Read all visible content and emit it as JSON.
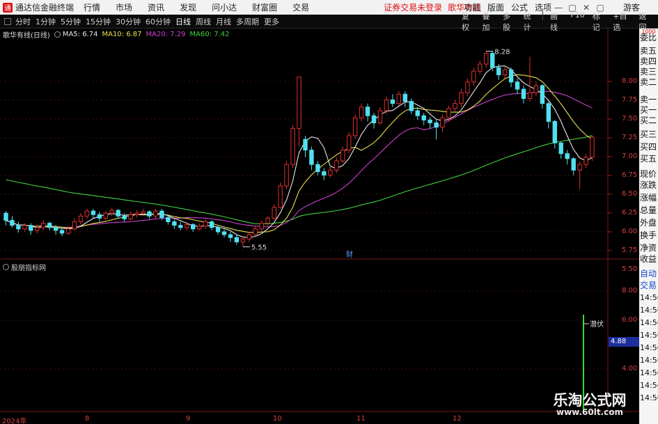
{
  "titlebar": {
    "app_title": "通达信金融终端",
    "logo_glyph": "通",
    "menu": [
      "行情",
      "市场",
      "资讯",
      "发现",
      "问小达",
      "财富圈",
      "交易"
    ],
    "notice": "证券交易未登录",
    "stock_name": "歌华有线",
    "right_menu": [
      "功能",
      "版面",
      "公式",
      "选项"
    ],
    "window_controls": [
      "—",
      "□",
      "✕",
      "▢"
    ],
    "guest": "游客"
  },
  "toolbar": {
    "periods": [
      "分时",
      "1分钟",
      "5分钟",
      "15分钟",
      "30分钟",
      "60分钟",
      "日线",
      "周线",
      "月线",
      "多周期",
      "更多"
    ],
    "active_period": "日线",
    "right_buttons": [
      "复权",
      "叠加",
      "多股",
      "统计",
      "画线",
      "F10",
      "标记",
      "+自选",
      "返回"
    ]
  },
  "legend": {
    "stock_label": "歌华有线(日线)",
    "ma": [
      {
        "label": "MA5: 6.74",
        "color": "#e8e8e8"
      },
      {
        "label": "MA10: 6.87",
        "color": "#e8e050"
      },
      {
        "label": "MA20: 7.29",
        "color": "#d040d0"
      },
      {
        "label": "MA60: 7.42",
        "color": "#40d040"
      }
    ]
  },
  "sub_panel": {
    "indicator_name": "股朋指标网",
    "signal_label": "潜伏",
    "readout": "4.88"
  },
  "axis": {
    "price_ticks": [
      "8.00",
      "7.75",
      "7.50",
      "7.25",
      "7.00",
      "6.75",
      "6.50",
      "6.25",
      "6.00",
      "5.75",
      "5.50"
    ],
    "sub_ticks": [
      "8.00",
      "6.00",
      "4.00"
    ],
    "dates": [
      "2024年",
      "8",
      "9",
      "10",
      "11",
      "12"
    ]
  },
  "annotations": {
    "high_label": "8.28",
    "low_label": "5.55",
    "finance_mark": "财"
  },
  "sidepanel": {
    "top_mark": "1000",
    "items": [
      "委比",
      "卖五",
      "卖四",
      "卖三",
      "卖二",
      "卖一",
      "买一",
      "买二",
      "买三",
      "买四",
      "买五",
      "现价",
      "涨跌",
      "涨幅",
      "总量",
      "外盘",
      "换手",
      "净资",
      "收益",
      "自动",
      "交易"
    ],
    "times": [
      "14:56",
      "14:56",
      "14:56",
      "14:56",
      "14:56",
      "14:56",
      "14:56",
      "14:56",
      "14:56"
    ]
  },
  "watermark": {
    "line1": "乐淘公式网",
    "line2": "www.60lt.com"
  },
  "chart_data": {
    "type": "candlestick",
    "price_range": [
      5.4,
      8.45
    ],
    "up_color": "#e03030",
    "down_color": "#50e0f0",
    "candles": [
      [
        6.02,
        5.92,
        6.05,
        5.85
      ],
      [
        5.92,
        5.85,
        5.98,
        5.82
      ],
      [
        5.85,
        5.8,
        5.9,
        5.75
      ],
      [
        5.8,
        5.85,
        5.88,
        5.76
      ],
      [
        5.85,
        5.78,
        5.88,
        5.72
      ],
      [
        5.78,
        5.82,
        5.86,
        5.74
      ],
      [
        5.82,
        5.88,
        5.92,
        5.78
      ],
      [
        5.88,
        5.82,
        5.9,
        5.78
      ],
      [
        5.82,
        5.78,
        5.85,
        5.72
      ],
      [
        5.78,
        5.74,
        5.82,
        5.7
      ],
      [
        5.74,
        5.8,
        5.84,
        5.72
      ],
      [
        5.8,
        5.9,
        5.95,
        5.78
      ],
      [
        5.9,
        5.98,
        6.02,
        5.86
      ],
      [
        5.98,
        6.05,
        6.08,
        5.94
      ],
      [
        6.05,
        6.0,
        6.08,
        5.95
      ],
      [
        6.0,
        5.95,
        6.04,
        5.9
      ],
      [
        5.95,
        6.02,
        6.05,
        5.92
      ],
      [
        6.02,
        6.06,
        6.1,
        5.98
      ],
      [
        6.06,
        5.98,
        6.08,
        5.94
      ],
      [
        5.98,
        5.94,
        6.02,
        5.9
      ],
      [
        5.94,
        6.0,
        6.04,
        5.92
      ],
      [
        6.0,
        6.02,
        6.06,
        5.96
      ],
      [
        6.02,
        6.04,
        6.08,
        5.98
      ],
      [
        6.04,
        5.98,
        6.06,
        5.94
      ],
      [
        5.98,
        6.05,
        6.08,
        5.95
      ],
      [
        6.05,
        5.96,
        6.08,
        5.92
      ],
      [
        5.96,
        5.9,
        6.0,
        5.86
      ],
      [
        5.9,
        5.85,
        5.94,
        5.8
      ],
      [
        5.85,
        5.82,
        5.9,
        5.78
      ],
      [
        5.82,
        5.86,
        5.9,
        5.78
      ],
      [
        5.86,
        5.8,
        5.88,
        5.76
      ],
      [
        5.8,
        5.84,
        5.88,
        5.78
      ],
      [
        5.84,
        5.9,
        5.94,
        5.8
      ],
      [
        5.9,
        5.82,
        5.92,
        5.78
      ],
      [
        5.82,
        5.76,
        5.85,
        5.72
      ],
      [
        5.76,
        5.72,
        5.8,
        5.68
      ],
      [
        5.72,
        5.68,
        5.76,
        5.62
      ],
      [
        5.68,
        5.62,
        5.72,
        5.58
      ],
      [
        5.62,
        5.66,
        5.7,
        5.55
      ],
      [
        5.66,
        5.72,
        5.76,
        5.62
      ],
      [
        5.72,
        5.8,
        5.84,
        5.7
      ],
      [
        5.8,
        5.88,
        5.92,
        5.76
      ],
      [
        5.88,
        5.95,
        5.98,
        5.84
      ],
      [
        5.95,
        6.1,
        6.14,
        5.92
      ],
      [
        6.1,
        6.4,
        6.45,
        6.08
      ],
      [
        6.4,
        6.7,
        6.75,
        6.35
      ],
      [
        6.7,
        7.2,
        7.25,
        6.65
      ],
      [
        7.2,
        7.92,
        7.92,
        6.95
      ],
      [
        7.05,
        6.9,
        7.1,
        6.8
      ],
      [
        6.9,
        6.7,
        6.95,
        6.62
      ],
      [
        6.7,
        6.6,
        6.75,
        6.55
      ],
      [
        6.6,
        6.55,
        6.65,
        6.48
      ],
      [
        6.55,
        6.62,
        6.68,
        6.52
      ],
      [
        6.62,
        6.75,
        6.8,
        6.58
      ],
      [
        6.75,
        6.9,
        6.95,
        6.72
      ],
      [
        6.9,
        7.1,
        7.15,
        6.85
      ],
      [
        7.1,
        7.35,
        7.4,
        7.05
      ],
      [
        7.35,
        7.5,
        7.55,
        7.3
      ],
      [
        7.5,
        7.38,
        7.55,
        7.3
      ],
      [
        7.38,
        7.28,
        7.42,
        7.2
      ],
      [
        7.28,
        7.45,
        7.5,
        7.25
      ],
      [
        7.45,
        7.6,
        7.65,
        7.4
      ],
      [
        7.6,
        7.55,
        7.68,
        7.5
      ],
      [
        7.55,
        7.68,
        7.72,
        7.52
      ],
      [
        7.68,
        7.58,
        7.72,
        7.5
      ],
      [
        7.58,
        7.45,
        7.62,
        7.4
      ],
      [
        7.45,
        7.38,
        7.5,
        7.32
      ],
      [
        7.38,
        7.32,
        7.42,
        7.25
      ],
      [
        7.32,
        7.28,
        7.36,
        7.2
      ],
      [
        7.28,
        7.22,
        7.32,
        7.05
      ],
      [
        7.22,
        7.35,
        7.4,
        7.15
      ],
      [
        7.35,
        7.48,
        7.52,
        7.3
      ],
      [
        7.48,
        7.55,
        7.6,
        7.44
      ],
      [
        7.55,
        7.7,
        7.75,
        7.5
      ],
      [
        7.7,
        7.85,
        7.9,
        7.65
      ],
      [
        7.85,
        8.0,
        8.05,
        7.8
      ],
      [
        8.0,
        8.1,
        8.15,
        7.95
      ],
      [
        8.1,
        8.25,
        8.28,
        8.05
      ],
      [
        8.25,
        8.05,
        8.28,
        8.0
      ],
      [
        8.05,
        7.95,
        8.1,
        7.88
      ],
      [
        7.95,
        8.02,
        8.06,
        7.9
      ],
      [
        8.02,
        7.85,
        8.05,
        7.78
      ],
      [
        7.85,
        7.75,
        7.9,
        7.68
      ],
      [
        7.75,
        7.62,
        7.8,
        7.55
      ],
      [
        7.62,
        7.7,
        8.2,
        7.58
      ],
      [
        7.7,
        7.8,
        7.85,
        7.65
      ],
      [
        7.8,
        7.55,
        7.82,
        7.48
      ],
      [
        7.55,
        7.3,
        7.58,
        7.2
      ],
      [
        7.3,
        7.0,
        7.32,
        6.92
      ],
      [
        7.0,
        6.85,
        7.02,
        6.78
      ],
      [
        6.85,
        6.78,
        6.9,
        6.7
      ],
      [
        6.78,
        6.62,
        6.8,
        6.55
      ],
      [
        6.62,
        6.7,
        6.74,
        6.35
      ],
      [
        6.7,
        6.8,
        6.85,
        6.65
      ],
      [
        6.8,
        7.08,
        7.1,
        6.75
      ]
    ]
  }
}
